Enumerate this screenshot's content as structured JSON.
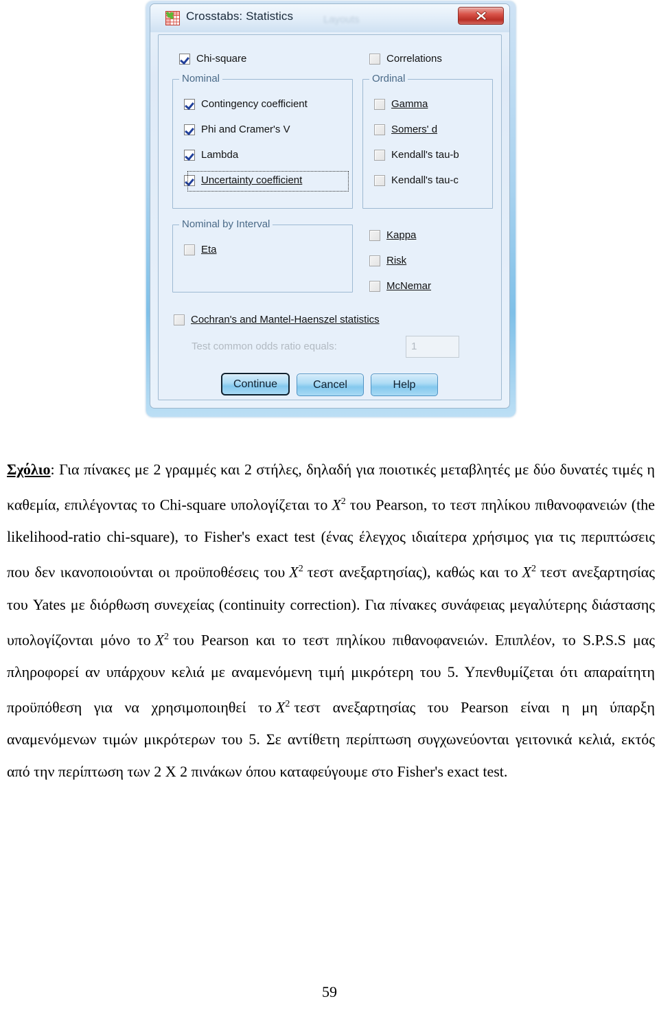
{
  "dialog": {
    "title": "Crosstabs: Statistics",
    "title_ghost": "Layouts",
    "icon": "crosstabs-table-icon",
    "close_label": "x",
    "accent_blue": "#84c8ee",
    "background": "#e7f0fa",
    "group_label_color": "#4a6a88",
    "checkbox_check_color": "#21409a",
    "top_checkboxes": [
      {
        "name": "chi-square",
        "label": "Chi-square",
        "mnemonic": "hi",
        "checked": true
      },
      {
        "name": "correlations",
        "label": "Correlations",
        "mnemonic": "rr",
        "checked": false
      }
    ],
    "groups": [
      {
        "name": "nominal",
        "title": "Nominal",
        "items": [
          {
            "name": "contingency-coefficient",
            "label": "Contingency coefficient",
            "checked": true,
            "focused": false
          },
          {
            "name": "phi-and-cramers-v",
            "label": "Phi and Cramer's V",
            "checked": true,
            "focused": false
          },
          {
            "name": "lambda",
            "label": "Lambda",
            "checked": true,
            "focused": false
          },
          {
            "name": "uncertainty-coefficient",
            "label": "Uncertainty coefficient",
            "checked": true,
            "focused": true
          }
        ]
      },
      {
        "name": "ordinal",
        "title": "Ordinal",
        "items": [
          {
            "name": "gamma",
            "label": "Gamma",
            "checked": false,
            "focused": false
          },
          {
            "name": "somers-d",
            "label": "Somers' d",
            "checked": false,
            "focused": false
          },
          {
            "name": "kendalls-tau-b",
            "label": "Kendall's tau-b",
            "checked": false,
            "focused": false
          },
          {
            "name": "kendalls-tau-c",
            "label": "Kendall's tau-c",
            "checked": false,
            "focused": false
          }
        ]
      },
      {
        "name": "nominal-by-interval",
        "title": "Nominal by Interval",
        "items": [
          {
            "name": "eta",
            "label": "Eta",
            "checked": false,
            "focused": false
          }
        ]
      }
    ],
    "right_checkboxes": [
      {
        "name": "kappa",
        "label": "Kappa",
        "checked": false
      },
      {
        "name": "risk",
        "label": "Risk",
        "checked": false
      },
      {
        "name": "mcnemar",
        "label": "McNemar",
        "checked": false
      }
    ],
    "cochran": {
      "label": "Cochran's and Mantel-Haenszel statistics",
      "checked": false,
      "odds_label": "Test common odds ratio equals:",
      "odds_value": "1",
      "disabled": true
    },
    "buttons": [
      {
        "name": "continue-button",
        "label": "Continue",
        "focused": true
      },
      {
        "name": "cancel-button",
        "label": "Cancel",
        "focused": false
      },
      {
        "name": "help-button",
        "label": "Help",
        "focused": false
      }
    ]
  },
  "document": {
    "paragraph_label": "Σχόλιο",
    "p1_a": ": Για πίνακες με 2 γραμμές και 2 στήλες, δηλαδή για ποιοτικές μεταβλητές με δύο δυνατές τιμές η καθεμία, επιλέγοντας το Chi-square υπολογίζεται το",
    "var1": "X",
    "sup1": "2",
    "p1_b": "του Pearson, το τεστ πηλίκου πιθανοφανειών (the likelihood-ratio chi-square), το   Fisher's exact test (ένας έλεγχος ιδιαίτερα χρήσιμος για τις περιπτώσεις που δεν ικανοποιούνται οι προϋποθέσεις του",
    "var2": "X",
    "sup2": "2",
    "p1_c": "τεστ ανεξαρτησίας), καθώς και το",
    "var3": "X",
    "sup3": "2",
    "p1_d": "τεστ ανεξαρτησίας του Yates με διόρθωση συνεχείας   (continuity correction). Για πίνακες συνάφειας μεγαλύτερης διάστασης υπολογίζονται μόνο το",
    "var4": "X",
    "sup4": "2",
    "p1_e": "του Pearson και το τεστ πηλίκου πιθανοφανειών. Επιπλέον, το S.P.S.S μας πληροφορεί αν υπάρχουν κελιά με αναμενόμενη τιμή μικρότερη του 5. Υπενθυμίζεται ότι απαραίτητη προϋπόθεση για να χρησιμοποιηθεί το",
    "var5": "X",
    "sup5": "2",
    "p1_f": "τεστ ανεξαρτησίας  του Pearson είναι η μη ύπαρξη αναμενόμενων τιμών μικρότερων του 5. Σε αντίθετη περίπτωση συγχωνεύονται  γειτονικά κελιά, εκτός από την περίπτωση των 2 X 2 πινάκων όπου καταφεύγουμε στο Fisher's exact test.",
    "page_number": "59"
  }
}
